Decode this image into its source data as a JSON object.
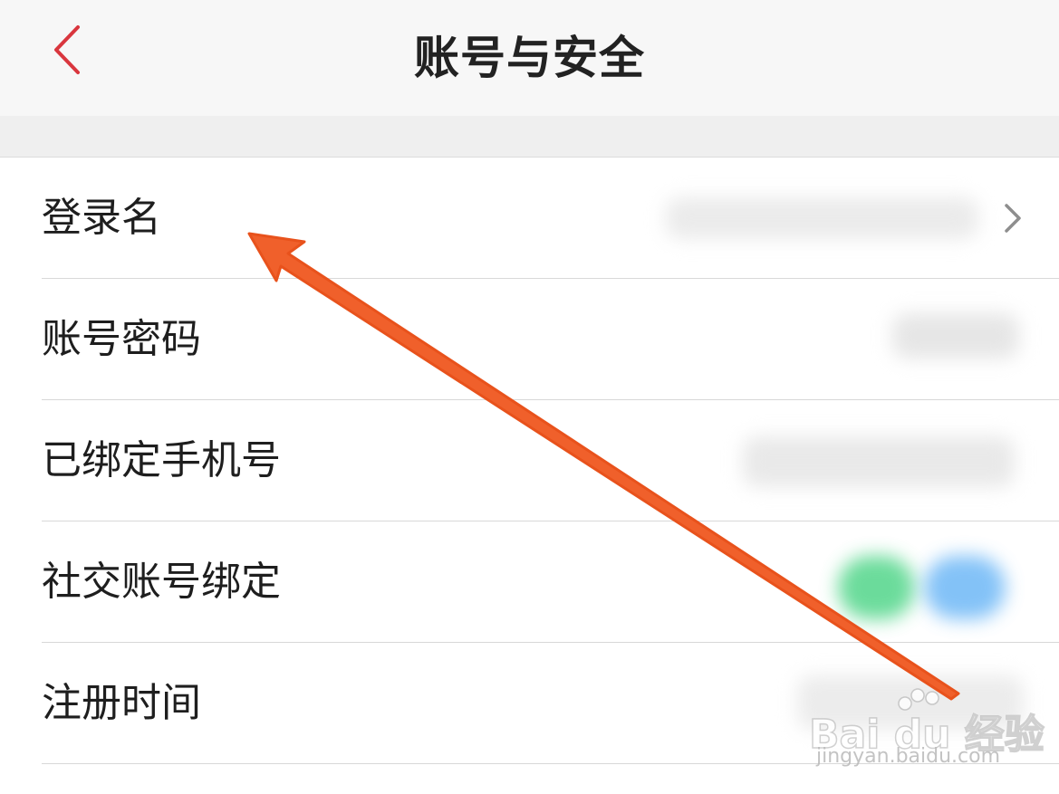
{
  "header": {
    "title": "账号与安全",
    "back_icon": "chevron-left-icon",
    "accent_color": "#d9363e"
  },
  "rows": [
    {
      "label": "登录名",
      "value_icon": "chevron-right-icon"
    },
    {
      "label": "账号密码"
    },
    {
      "label": "已绑定手机号"
    },
    {
      "label": "社交账号绑定",
      "social_colors": [
        "#3ad07a",
        "#5aaef5"
      ]
    },
    {
      "label": "注册时间"
    }
  ],
  "watermark": {
    "main": "Bai du 经验",
    "sub": "jingyan.baidu.com"
  },
  "annotation": {
    "arrow_color": "#f0602b"
  }
}
